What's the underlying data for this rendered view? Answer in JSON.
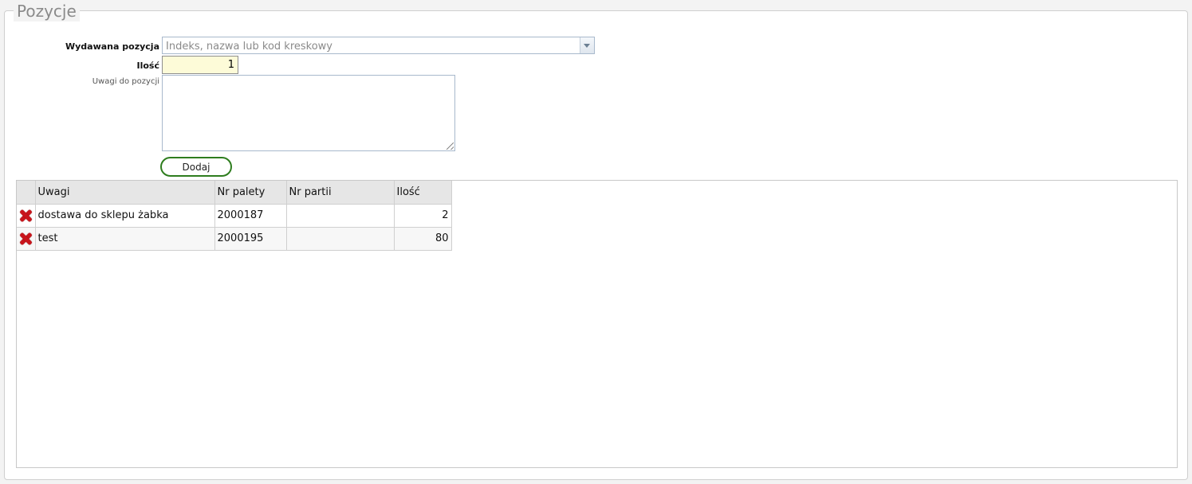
{
  "section": {
    "legend": "Pozycje"
  },
  "form": {
    "item_label": "Wydawana pozycja",
    "item_placeholder": "Indeks, nazwa lub kod kreskowy",
    "qty_label": "Ilość",
    "qty_value": "1",
    "notes_label": "Uwagi do pozycji",
    "notes_value": "",
    "add_button": "Dodaj"
  },
  "grid": {
    "columns": [
      "",
      "Uwagi",
      "Nr palety",
      "Nr partii",
      "Ilość"
    ],
    "rows": [
      {
        "uwagi": "dostawa do sklepu żabka",
        "nr_palety": "2000187",
        "nr_partii": "",
        "ilosc": "2"
      },
      {
        "uwagi": "test",
        "nr_palety": "2000195",
        "nr_partii": "",
        "ilosc": "80"
      }
    ]
  },
  "colors": {
    "accent_border": "#2e7d1e",
    "delete": "#c9141b",
    "qty_bg": "#fdfbd8"
  }
}
